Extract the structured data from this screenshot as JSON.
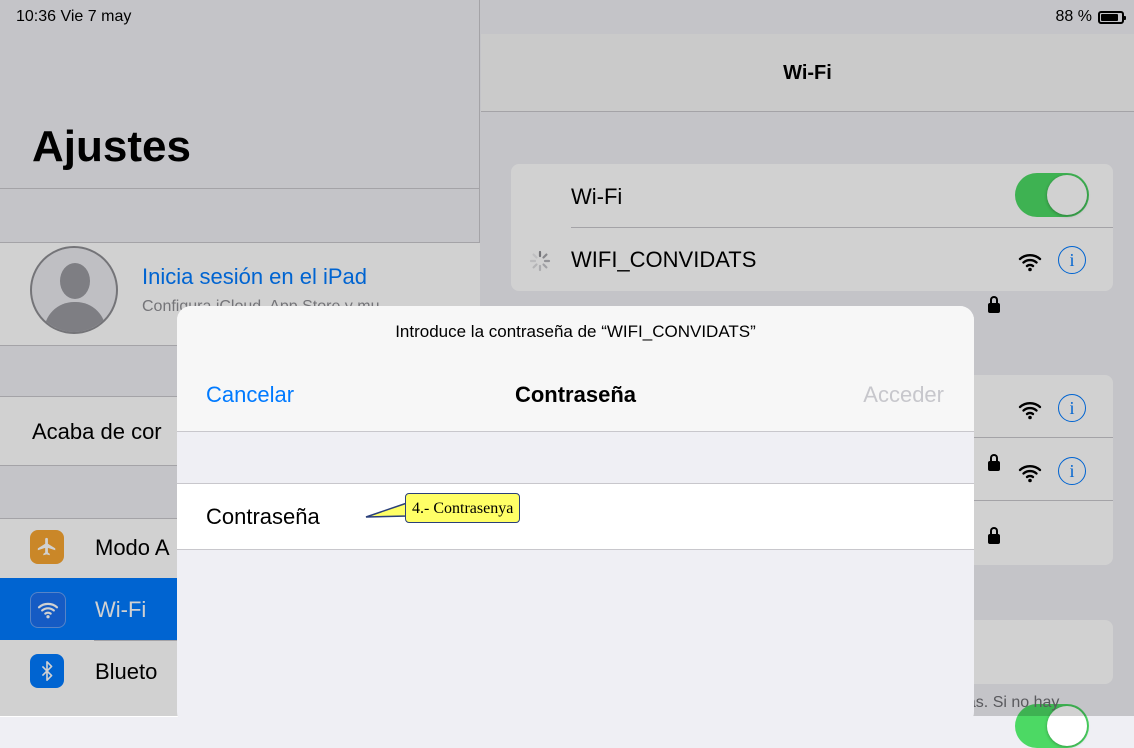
{
  "status_bar": {
    "time": "10:36  Vie 7 may",
    "battery_text": "88 %",
    "battery_level": 0.88
  },
  "sidebar": {
    "title": "Ajustes",
    "profile": {
      "title": "Inicia sesión en el iPad",
      "subtitle": "Configura iCloud, App Store y mu"
    },
    "recent": "Acaba de cor",
    "items": [
      {
        "label": "Modo A",
        "icon": "airplane-icon",
        "color": "#f7a531"
      },
      {
        "label": "Wi-Fi",
        "icon": "wifi-icon",
        "color": "#007aff",
        "selected": true
      },
      {
        "label": "Blueto",
        "icon": "bluetooth-icon",
        "color": "#007aff"
      }
    ]
  },
  "wifi_panel": {
    "nav_title": "Wi-Fi",
    "wifi_toggle_label": "Wi-Fi",
    "wifi_on": true,
    "connecting_network": "WIFI_CONVIDATS",
    "footer_fragment": "das. Si no hay"
  },
  "modal": {
    "prompt": "Introduce la contraseña de “WIFI_CONVIDATS”",
    "cancel": "Cancelar",
    "title": "Contraseña",
    "join": "Acceder",
    "password_label": "Contraseña",
    "password_value": ""
  },
  "callout": {
    "text": "4.- Contrasenya"
  },
  "colors": {
    "accent": "#007aff",
    "toggle_on": "#4cd964",
    "callout_fill": "#ffff66"
  }
}
